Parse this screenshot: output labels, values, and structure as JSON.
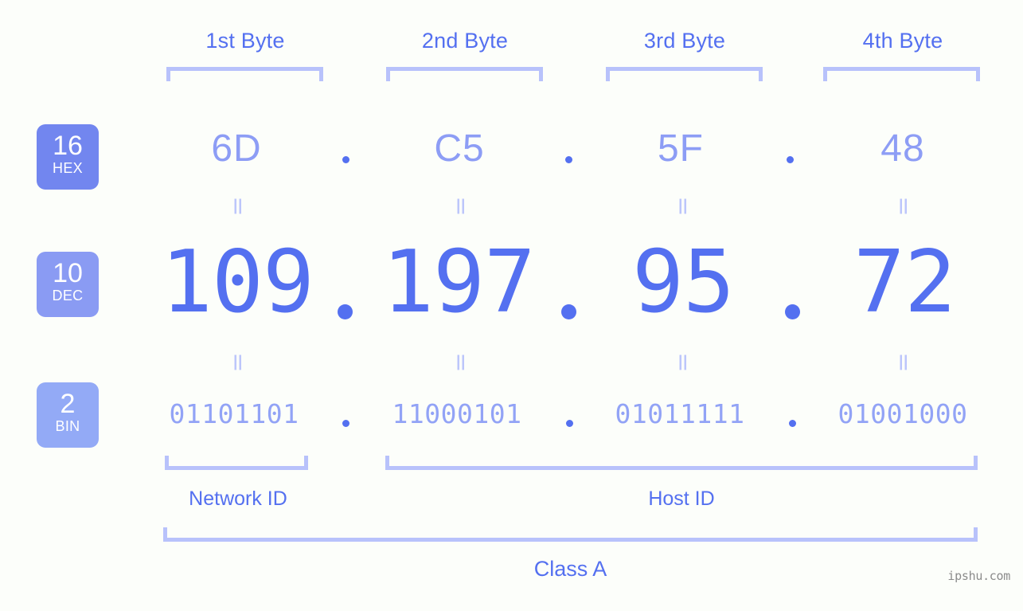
{
  "background_color": "#fcfefa",
  "accent_color": "#5470f0",
  "light_accent_color": "#b8c2fb",
  "header": {
    "bytes": [
      {
        "label": "1st Byte"
      },
      {
        "label": "2nd Byte"
      },
      {
        "label": "3rd Byte"
      },
      {
        "label": "4th Byte"
      }
    ]
  },
  "bases": [
    {
      "id": "hex",
      "number": "16",
      "name": "HEX",
      "color": "#7286ef"
    },
    {
      "id": "dec",
      "number": "10",
      "name": "DEC",
      "color": "#8a9bf3"
    },
    {
      "id": "bin",
      "number": "2",
      "name": "BIN",
      "color": "#93aaf6"
    }
  ],
  "rows": {
    "hex": {
      "values": [
        "6D",
        "C5",
        "5F",
        "48"
      ],
      "separator": "."
    },
    "dec": {
      "values": [
        "109",
        "197",
        "95",
        "72"
      ],
      "separator": "."
    },
    "bin": {
      "values": [
        "01101101",
        "11000101",
        "01011111",
        "01001000"
      ],
      "separator": "."
    }
  },
  "equals_symbol": "=",
  "footer": {
    "network_id": "Network ID",
    "host_id": "Host ID",
    "class": "Class A"
  },
  "watermark": "ipshu.com"
}
